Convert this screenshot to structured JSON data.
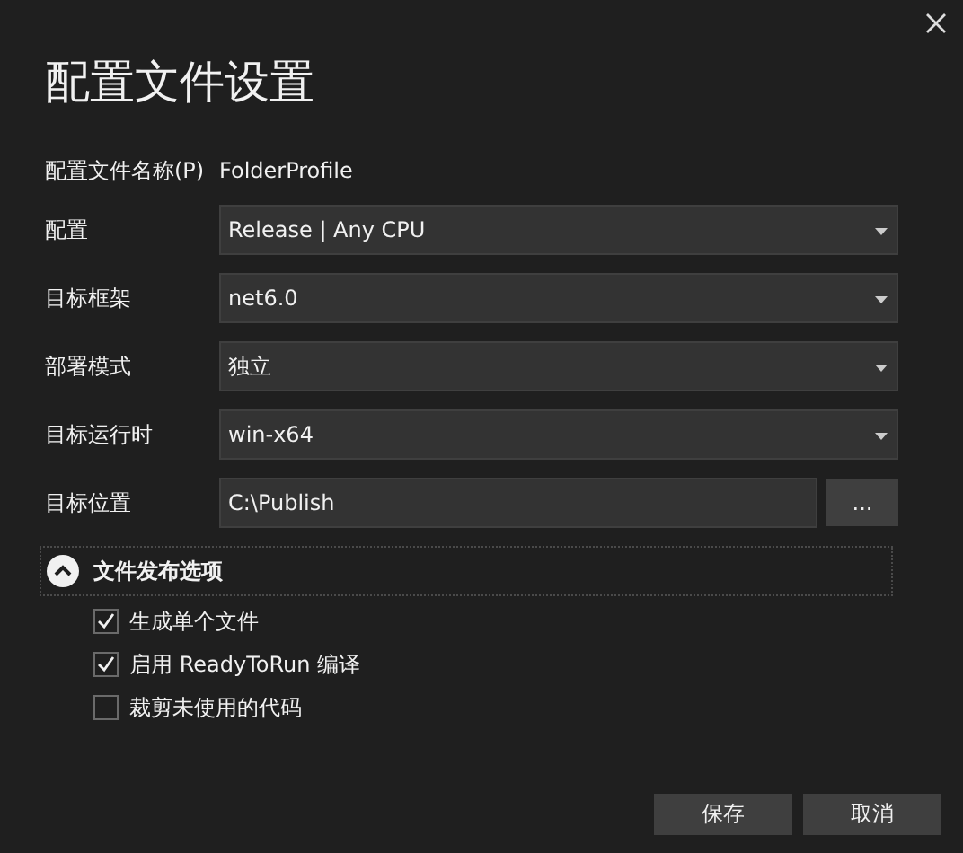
{
  "dialog": {
    "title": "配置文件设置"
  },
  "profile_name": {
    "label": "配置文件名称(P)",
    "value": "FolderProfile"
  },
  "fields": [
    {
      "kind": "dropdown",
      "label": "配置",
      "value": "Release | Any CPU"
    },
    {
      "kind": "dropdown",
      "label": "目标框架",
      "value": "net6.0"
    },
    {
      "kind": "dropdown",
      "label": "部署模式",
      "value": "独立"
    },
    {
      "kind": "dropdown",
      "label": "目标运行时",
      "value": "win-x64"
    },
    {
      "kind": "path",
      "label": "目标位置",
      "value": "C:\\Publish",
      "button": "..."
    }
  ],
  "section": {
    "title": "文件发布选项",
    "expanded": true,
    "options": [
      {
        "label": "生成单个文件",
        "checked": true
      },
      {
        "label": "启用 ReadyToRun 编译",
        "checked": true
      },
      {
        "label": "裁剪未使用的代码",
        "checked": false
      }
    ]
  },
  "buttons": [
    "保存",
    "取消"
  ]
}
